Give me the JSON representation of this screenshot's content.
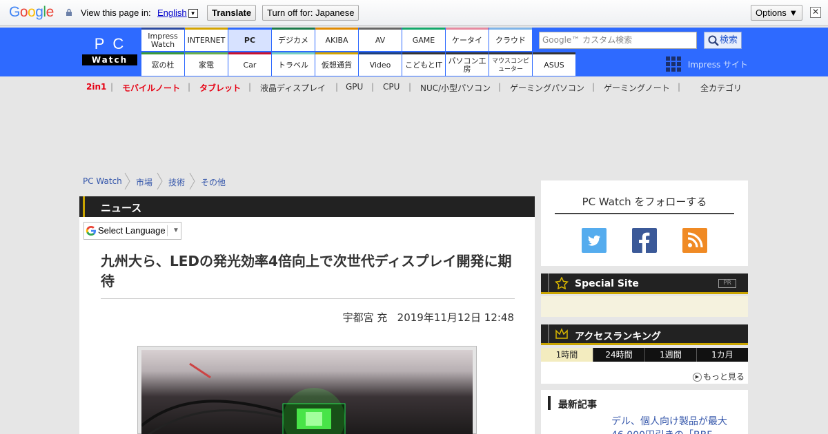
{
  "translate_bar": {
    "logo": "Google",
    "prompt": "View this page in:",
    "language": "English",
    "translate_button": "Translate",
    "turn_off_button": "Turn off for: Japanese",
    "options_button": "Options ▼",
    "close_glyph": "✕"
  },
  "header": {
    "logo_top": "PC",
    "logo_bottom": "Watch",
    "nav_row1": [
      "Impress Watch",
      "INTERNET",
      "PC",
      "デジカメ",
      "AKIBA",
      "AV",
      "GAME",
      "ケータイ",
      "クラウド"
    ],
    "nav_row2": [
      "窓の杜",
      "家電",
      "Car",
      "トラベル",
      "仮想通貨",
      "Video",
      "こどもとIT",
      "パソコン工房",
      "マウスコンピューター",
      "ASUS"
    ],
    "nav_colors_row1": [
      "#2b4aa0",
      "#d4a400",
      "#2e6aff",
      "#1a7a4a",
      "#e08a00",
      "#666666",
      "#13a86b",
      "#e68aa0",
      "#7fb4e8"
    ],
    "nav_colors_row2": [
      "#3a9a3a",
      "#6ab04c",
      "#c8102e",
      "#7ad0c0",
      "#d4a400",
      "#1f3f7a",
      "#333333",
      "#333333",
      "#333333",
      "#333333"
    ],
    "search_placeholder": "Google™ カスタム検索",
    "search_button": "検索",
    "impress_site": "Impress サイト"
  },
  "categories": [
    {
      "label": "2in1",
      "highlight": true
    },
    {
      "label": "モバイルノート",
      "highlight": true
    },
    {
      "label": "タブレット",
      "highlight": true
    },
    {
      "label": "液晶ディスプレイ",
      "highlight": false
    },
    {
      "label": "GPU",
      "highlight": false
    },
    {
      "label": "CPU",
      "highlight": false
    },
    {
      "label": "NUC/小型パソコン",
      "highlight": false
    },
    {
      "label": "ゲーミングパソコン",
      "highlight": false
    },
    {
      "label": "ゲーミングノート",
      "highlight": false
    }
  ],
  "all_categories": "全カテゴリ",
  "breadcrumb": [
    "PC Watch",
    "市場",
    "技術",
    "その他"
  ],
  "article": {
    "section": "ニュース",
    "select_language": "Select Language",
    "title": "九州大ら、LEDの発光効率4倍向上で次世代ディスプレイ開発に期待",
    "author": "宇都宮 充",
    "date": "2019年11月12日 12:48"
  },
  "sidebar": {
    "follow_title": "PC Watch をフォローする",
    "social": [
      "twitter-icon",
      "facebook-icon",
      "rss-icon"
    ],
    "special_site": "Special Site",
    "pr": "PR",
    "ranking_title": "アクセスランキング",
    "ranking_tabs": [
      "1時間",
      "24時間",
      "1週間",
      "1カ月"
    ],
    "more": "もっと見る",
    "latest_title": "最新記事",
    "latest_article": "デル、個人向け製品が最大46,000円引きの「BBF"
  }
}
